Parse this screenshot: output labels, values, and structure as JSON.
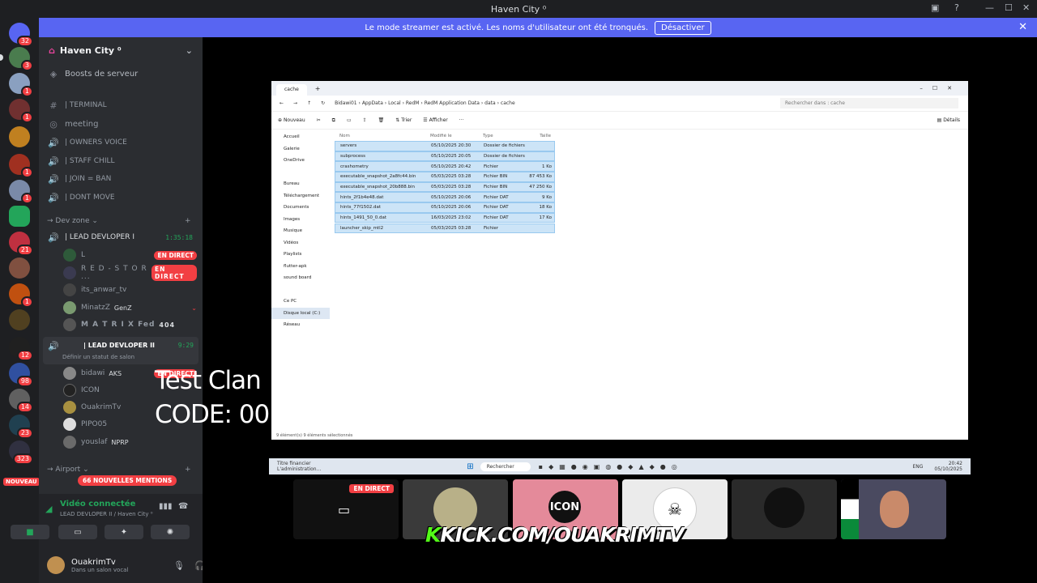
{
  "window": {
    "title": "Haven City ⁰",
    "controls": [
      "—",
      "☐",
      "✕"
    ]
  },
  "banner": {
    "text": "Le mode streamer est activé. Les noms d'utilisateur ont été tronqués.",
    "button": "Désactiver"
  },
  "rail": {
    "badges": [
      "32",
      "3",
      "1",
      "1",
      "1",
      "1",
      "1",
      "1",
      "21",
      "1",
      "12",
      "98",
      "14",
      "23",
      "323"
    ],
    "new_label": "NOUVEAU"
  },
  "server": {
    "name": "Haven City ⁰",
    "boosts": "Boosts de serveur"
  },
  "channels": [
    {
      "icon": "#",
      "name": "| TERMINAL"
    },
    {
      "icon": "◎",
      "name": "meeting"
    },
    {
      "icon": "🔊",
      "name": "| OWNERS VOICE"
    },
    {
      "icon": "🔊",
      "name": "| STAFF CHILL"
    },
    {
      "icon": "🔊",
      "name": "| JOIN = BAN"
    },
    {
      "icon": "🔊",
      "name": "| DONT MOVE"
    }
  ],
  "devzone": {
    "category": "Dev zone",
    "lead1": {
      "name": "| LEAD DEVLOPER I",
      "time": "1:35:18"
    },
    "users1": [
      {
        "name": "L",
        "live": "EN DIRECT"
      },
      {
        "name": "R E D - S T O R ...",
        "live": "EN DIRECT"
      },
      {
        "name": "its_anwar_tv"
      },
      {
        "name": "MinatzZ",
        "tag": "GenZ"
      },
      {
        "name": "M A T R I X Fed",
        "tag": "404"
      }
    ],
    "lead2": {
      "name": "| LEAD DEVLOPER II",
      "time": "9:29",
      "status": "Définir un statut de salon"
    },
    "users2": [
      {
        "name": "bidawi",
        "tag": "AKS",
        "live": "EN DIRECT"
      },
      {
        "name": "ICON"
      },
      {
        "name": "OuakrimTv"
      },
      {
        "name": "PIPO05"
      },
      {
        "name": "youslaf",
        "tag": "NPRP"
      }
    ]
  },
  "airport": {
    "category": "Airport",
    "mentions": "66 NOUVELLES MENTIONS"
  },
  "voice": {
    "status": "Vidéo connectée",
    "channel": "LEAD DEVLOPER II / Haven City ⁰"
  },
  "user": {
    "name": "OuakrimTv",
    "sub": "Dans un salon vocal"
  },
  "explorer": {
    "tab": "cache",
    "path": [
      "Bidawi01",
      "AppData",
      "Local",
      "RedM",
      "RedM Application Data",
      "data",
      "cache"
    ],
    "search": "Rechercher dans : cache",
    "toolbar": {
      "new": "Nouveau",
      "sort": "Trier",
      "view": "Afficher",
      "details": "Détails"
    },
    "nav": [
      "Accueil",
      "Galerie",
      "OneDrive",
      "",
      "Bureau",
      "Téléchargement",
      "Documents",
      "Images",
      "Musique",
      "Vidéos",
      "Playlists",
      "flutter-apk",
      "sound board",
      "",
      "Ce PC",
      "Disque local (C:)",
      "Réseau"
    ],
    "headers": [
      "Nom",
      "Modifié le",
      "Type",
      "Taille"
    ],
    "files": [
      [
        "servers",
        "05/10/2025 20:30",
        "Dossier de fichiers",
        ""
      ],
      [
        "subprocess",
        "05/10/2025 20:05",
        "Dossier de fichiers",
        ""
      ],
      [
        "crashometry",
        "05/10/2025 20:42",
        "Fichier",
        "1 Ko"
      ],
      [
        "executable_snapshot_2a8fc44.bin",
        "05/03/2025 03:28",
        "Fichier BIN",
        "87 453 Ko"
      ],
      [
        "executable_snapshot_20b888.bin",
        "05/03/2025 03:28",
        "Fichier BIN",
        "47 250 Ko"
      ],
      [
        "hints_2f1b4e48.dat",
        "05/10/2025 20:06",
        "Fichier DAT",
        "9 Ko"
      ],
      [
        "hints_77f1502.dat",
        "05/10/2025 20:06",
        "Fichier DAT",
        "18 Ko"
      ],
      [
        "hints_1491_50_0.dat",
        "16/03/2025 23:02",
        "Fichier DAT",
        "17 Ko"
      ],
      [
        "launcher_skip_mtl2",
        "05/03/2025 03:28",
        "Fichier",
        ""
      ]
    ],
    "status": "9 élément(s)     9 éléments sélectionnés"
  },
  "taskbar": {
    "app": "Titre financier",
    "app_sub": "L'administration...",
    "search": "Rechercher",
    "lang": "ENG",
    "time": "20:42",
    "date": "05/10/2025"
  },
  "overlay": {
    "line1": "Test Clan",
    "line2": "CODE: 00"
  },
  "tiles": {
    "live": "EN DIRECT"
  },
  "kick": {
    "k": "K",
    "rest": "KICK.COM/OUAKRIMTV"
  }
}
